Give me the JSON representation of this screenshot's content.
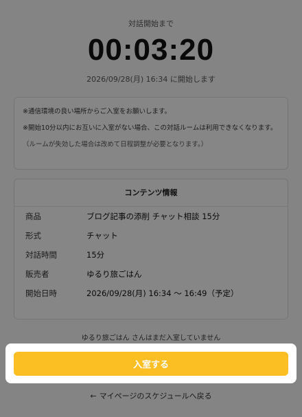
{
  "header": {
    "countdown_label": "対話開始まで",
    "countdown": "00:03:20",
    "start_text": "2026/09/28(月) 16:34 に開始します"
  },
  "notice": {
    "line1": "※通信環境の良い場所からご入室をお願いします。",
    "line2": "※開始10分以内にお互いに入室がない場合、この対話ルームは利用できなくなります。",
    "line3": "（ルームが失効した場合は改めて日程調整が必要となります。）"
  },
  "info": {
    "title": "コンテンツ情報",
    "rows": [
      {
        "key": "商品",
        "value": "ブログ記事の添削 チャット相談 15分"
      },
      {
        "key": "形式",
        "value": "チャット"
      },
      {
        "key": "対話時間",
        "value": "15分"
      },
      {
        "key": "販売者",
        "value": "ゆるり旅ごはん"
      },
      {
        "key": "開始日時",
        "value": "2026/09/28(月) 16:34 〜 16:49（予定）"
      }
    ]
  },
  "footer": {
    "waiting_text": "ゆるり旅ごはん さんはまだ入室していません",
    "enter_button": "入室する",
    "back_arrow": "←",
    "back_link": "マイページのスケジュールへ戻る"
  },
  "colors": {
    "accent": "#fbbf24",
    "overlay": "rgba(0,0,0,0.46)"
  }
}
